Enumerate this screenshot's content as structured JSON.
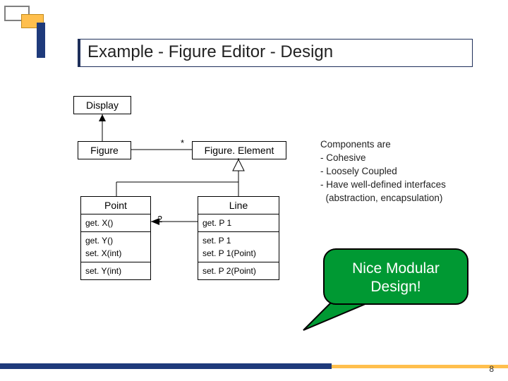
{
  "title": "Example - Figure Editor - Design",
  "classes": {
    "display": "Display",
    "figure": "Figure",
    "figureElement": "Figure. Element",
    "point": {
      "name": "Point",
      "ops": [
        "get. X()",
        "get. Y()",
        "set. X(int)",
        "set. Y(int)"
      ]
    },
    "line": {
      "name": "Line",
      "ops": [
        "get. P 1",
        "set. P 1",
        "set. P 1(Point)",
        "set. P 2(Point)"
      ]
    }
  },
  "mults": {
    "star": "*",
    "two": "2"
  },
  "notes": [
    "Components are",
    "- Cohesive",
    "- Loosely Coupled",
    "- Have well-defined interfaces",
    "  (abstraction, encapsulation)"
  ],
  "callout": {
    "l1": "Nice Modular",
    "l2": "Design!"
  },
  "page": "8"
}
